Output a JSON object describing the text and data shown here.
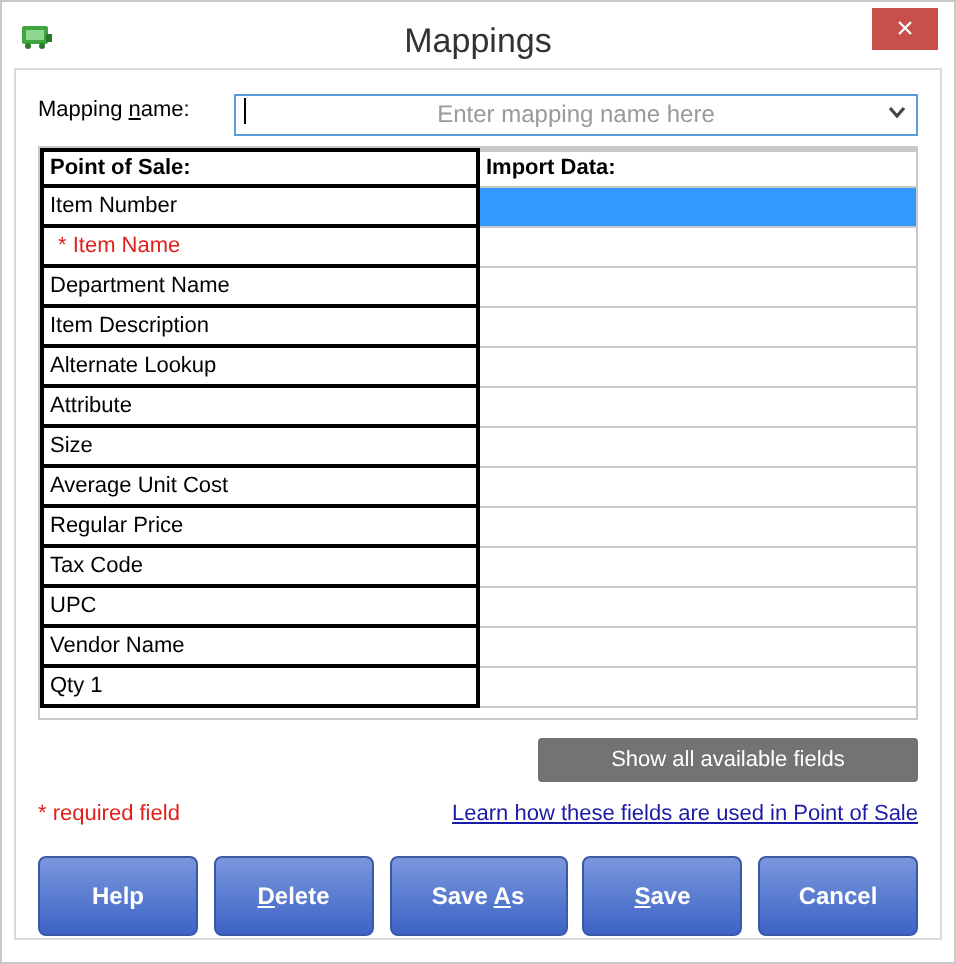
{
  "window": {
    "title": "Mappings",
    "close": "×"
  },
  "mapping_name": {
    "label_parts": {
      "before": "Mapping ",
      "key": "n",
      "after": "ame:"
    },
    "placeholder": "Enter mapping name here"
  },
  "table": {
    "columns": [
      "Point of Sale:",
      "Import Data:"
    ],
    "rows": [
      {
        "field": "Item Number",
        "required": false,
        "selected": true
      },
      {
        "field": "* Item Name",
        "required": true,
        "selected": false
      },
      {
        "field": "Department Name",
        "required": false,
        "selected": false
      },
      {
        "field": "Item Description",
        "required": false,
        "selected": false
      },
      {
        "field": "Alternate Lookup",
        "required": false,
        "selected": false
      },
      {
        "field": "Attribute",
        "required": false,
        "selected": false
      },
      {
        "field": "Size",
        "required": false,
        "selected": false
      },
      {
        "field": "Average Unit Cost",
        "required": false,
        "selected": false
      },
      {
        "field": "Regular Price",
        "required": false,
        "selected": false
      },
      {
        "field": "Tax Code",
        "required": false,
        "selected": false
      },
      {
        "field": "UPC",
        "required": false,
        "selected": false
      },
      {
        "field": "Vendor Name",
        "required": false,
        "selected": false
      },
      {
        "field": "Qty 1",
        "required": false,
        "selected": false
      }
    ]
  },
  "show_all_button": "Show all available fields",
  "required_note": "* required field",
  "help_link": "Learn how these fields are used in Point of Sale",
  "buttons": [
    {
      "label_parts": {
        "before": "Help"
      }
    },
    {
      "label_parts": {
        "key": "D",
        "after": "elete"
      }
    },
    {
      "label_parts": {
        "before": "Save ",
        "key": "A",
        "after": "s"
      }
    },
    {
      "label_parts": {
        "key": "S",
        "after": "ave"
      }
    },
    {
      "label_parts": {
        "before": "Cancel"
      }
    }
  ]
}
